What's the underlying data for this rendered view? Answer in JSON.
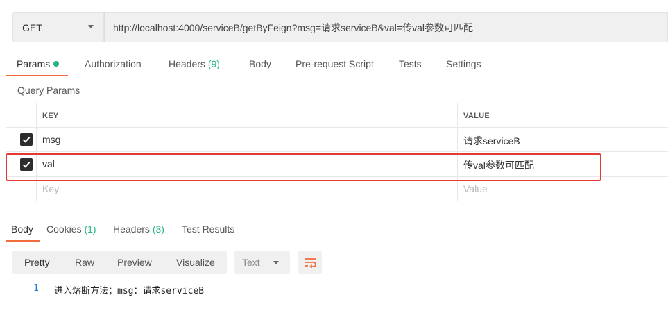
{
  "request": {
    "method": "GET",
    "url": "http://localhost:4000/serviceB/getByFeign?msg=请求serviceB&val=传val参数可匹配"
  },
  "request_tabs": [
    {
      "label": "Params",
      "active": true,
      "dot": true
    },
    {
      "label": "Authorization"
    },
    {
      "label": "Headers",
      "count": "(9)"
    },
    {
      "label": "Body"
    },
    {
      "label": "Pre-request Script"
    },
    {
      "label": "Tests"
    },
    {
      "label": "Settings"
    }
  ],
  "query_params": {
    "title": "Query Params",
    "col_key": "KEY",
    "col_value": "VALUE",
    "rows": [
      {
        "checked": true,
        "key": "msg",
        "value": "请求serviceB"
      },
      {
        "checked": true,
        "key": "val",
        "value": "传val参数可匹配"
      }
    ],
    "placeholder_key": "Key",
    "placeholder_value": "Value"
  },
  "response_tabs": [
    {
      "label": "Body",
      "active": true
    },
    {
      "label": "Cookies",
      "count": "(1)"
    },
    {
      "label": "Headers",
      "count": "(3)"
    },
    {
      "label": "Test Results"
    }
  ],
  "view_modes": [
    "Pretty",
    "Raw",
    "Preview",
    "Visualize"
  ],
  "format": "Text",
  "response_body": [
    {
      "line": "1",
      "text": "进入熔断方法；msg：请求serviceB"
    }
  ],
  "colors": {
    "accent": "#f26b3a",
    "green": "#26b47f",
    "highlight": "#e53935"
  }
}
